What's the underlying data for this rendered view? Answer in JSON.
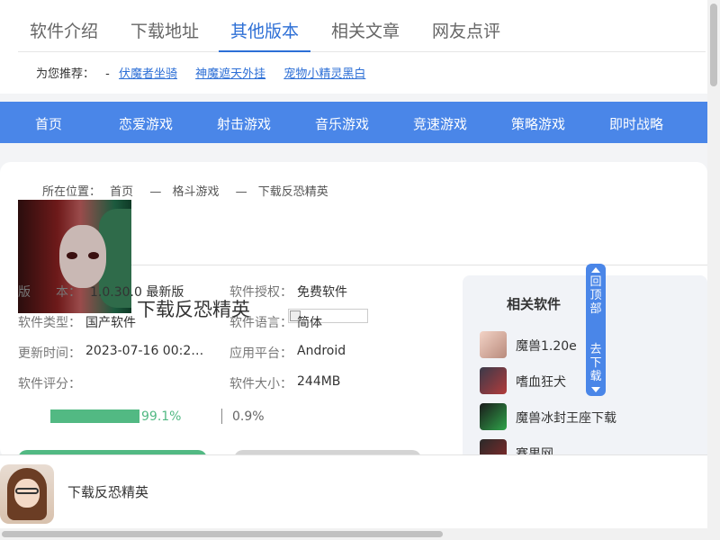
{
  "tabs": [
    {
      "label": "软件介绍"
    },
    {
      "label": "下载地址"
    },
    {
      "label": "其他版本"
    },
    {
      "label": "相关文章"
    },
    {
      "label": "网友点评"
    }
  ],
  "recommend": {
    "label": "为您推荐：",
    "dash": "-",
    "links": [
      "伏魔者坐骑",
      "神魔遮天外挂",
      "宠物小精灵黑白"
    ]
  },
  "nav": [
    "首页",
    "恋爱游戏",
    "射击游戏",
    "音乐游戏",
    "竞速游戏",
    "策略游戏",
    "即时战略"
  ],
  "breadcrumb": {
    "prefix": "所在位置：",
    "items": [
      "首页",
      "格斗游戏",
      "下载反恐精英"
    ],
    "sep": "—"
  },
  "app": {
    "title": "下载反恐精英"
  },
  "info": {
    "version_label": "版　　本：",
    "version": "1.0.30.0 最新版",
    "license_label": "软件授权：",
    "license": "免费软件",
    "type_label": "软件类型：",
    "type": "国产软件",
    "lang_label": "软件语言：",
    "lang": "简体",
    "update_label": "更新时间：",
    "update": "2023-07-16 00:2…",
    "platform_label": "应用平台：",
    "platform": "Android",
    "score_label": "软件评分：",
    "size_label": "软件大小：",
    "size": "244MB"
  },
  "rating": {
    "good_percent": 99.1,
    "good": "99.1%",
    "bad": "0.9%"
  },
  "related": {
    "title": "相关软件",
    "items": [
      {
        "label": "魔兽1.20e"
      },
      {
        "label": "嗜血狂犬"
      },
      {
        "label": "魔兽冰封王座下载"
      },
      {
        "label": "赛果网"
      }
    ]
  },
  "side_tool": {
    "top": "回顶部",
    "download": "去下载"
  },
  "sticky": {
    "title": "下载反恐精英"
  },
  "colors": {
    "accent": "#4a86e8",
    "tab_active": "#2d6fd6",
    "green": "#52b983"
  }
}
